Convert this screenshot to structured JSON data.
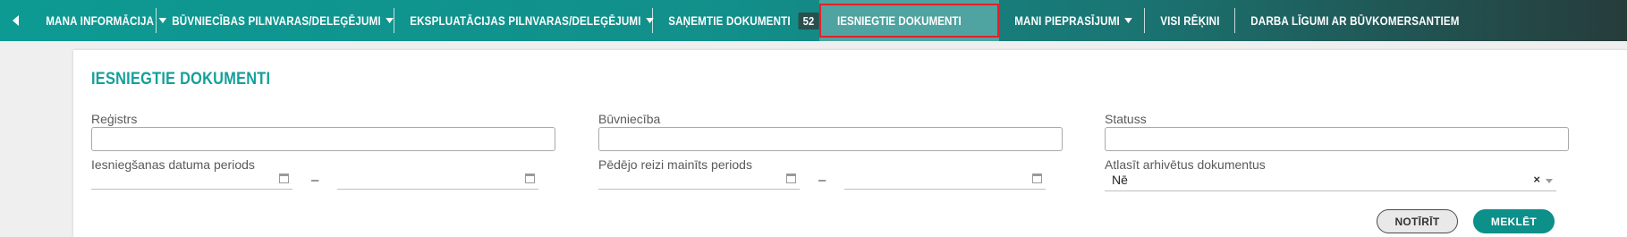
{
  "nav": {
    "items": [
      {
        "label": "MANA INFORMĀCIJA",
        "has_caret": true
      },
      {
        "label": "BŪVNIECĪBAS PILNVARAS/DELEĢĒJUMI",
        "has_caret": true
      },
      {
        "label": "EKSPLUATĀCIJAS PILNVARAS/DELEĢĒJUMI",
        "has_caret": true
      },
      {
        "label": "SAŅEMTIE DOKUMENTI",
        "badge": "52"
      },
      {
        "label": "IESNIEGTIE DOKUMENTI",
        "active": true
      },
      {
        "label": "MANI PIEPRASĪJUMI",
        "has_caret": true
      },
      {
        "label": "VISI RĒĶINI"
      },
      {
        "label": "DARBA LĪGUMI AR BŪVKOMERSANTIEM"
      }
    ],
    "back_icon": "chevron-left-icon"
  },
  "page": {
    "title": "IESNIEGTIE DOKUMENTI"
  },
  "filters": {
    "registrs_label": "Reģistrs",
    "buvnieciba_label": "Būvniecība",
    "statuss_label": "Statuss",
    "submission_period_label": "Iesniegšanas datuma periods",
    "changed_period_label": "Pēdējo reizi mainīts periods",
    "archived_label": "Atlasīt arhivētus dokumentus",
    "archived_value": "Nē",
    "range_separator": "–"
  },
  "buttons": {
    "clear_label": "NOTĪRĪT",
    "search_label": "MEKLĒT"
  },
  "colors": {
    "accent": "#14a09a",
    "active_tab_border": "#e3202a"
  }
}
